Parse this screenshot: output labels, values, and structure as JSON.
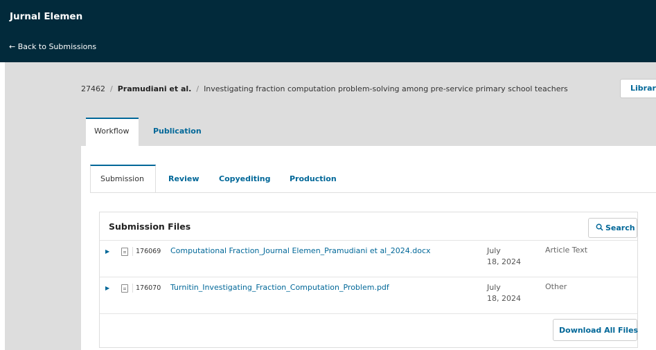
{
  "header": {
    "journal_title": "Jurnal Elemen",
    "back_link": "← Back to Submissions"
  },
  "submission": {
    "id": "27462",
    "author": "Pramudiani et al.",
    "title": "Investigating fraction computation problem-solving among pre-service primary school teachers",
    "library_button": "Library"
  },
  "main_tabs": [
    {
      "label": "Workflow",
      "active": true
    },
    {
      "label": "Publication",
      "active": false
    }
  ],
  "sub_tabs": [
    {
      "label": "Submission",
      "active": true
    },
    {
      "label": "Review",
      "active": false
    },
    {
      "label": "Copyediting",
      "active": false
    },
    {
      "label": "Production",
      "active": false
    }
  ],
  "files_panel": {
    "title": "Submission Files",
    "search_button": "Search",
    "files": [
      {
        "id": "176069",
        "name": "Computational Fraction_Journal Elemen_Pramudiani et al_2024.docx",
        "date_line1": "July",
        "date_line2": "18, 2024",
        "type": "Article Text"
      },
      {
        "id": "176070",
        "name": "Turnitin_Investigating_Fraction_Computation_Problem.pdf",
        "date_line1": "July",
        "date_line2": "18, 2024",
        "type": "Other"
      }
    ],
    "download_button": "Download All Files"
  },
  "colors": {
    "header_bg": "#022a3b",
    "link": "#006798",
    "canvas_bg": "#dddddd"
  },
  "icons": {
    "search": "search-icon",
    "expand": "caret-right-icon",
    "file": "file-icon"
  }
}
